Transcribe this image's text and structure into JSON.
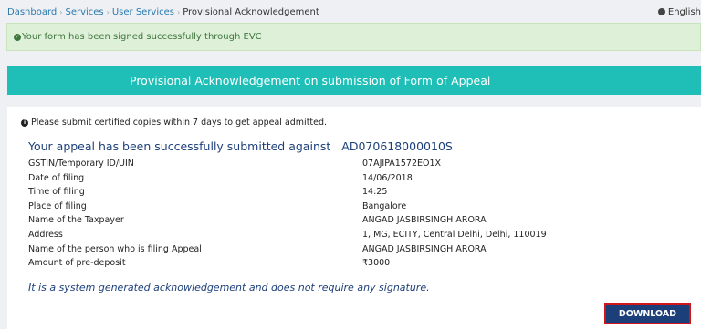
{
  "breadcrumb": {
    "items": [
      "Dashboard",
      "Services",
      "User Services"
    ],
    "current": "Provisional Acknowledgement"
  },
  "language": {
    "label": "English",
    "icon": "globe-icon"
  },
  "alert": {
    "text": "Your form has been signed successfully through EVC",
    "icon": "check-circle-icon",
    "color": "#3c763d"
  },
  "banner": {
    "title": "Provisional Acknowledgement on submission of Form of Appeal",
    "color": "#1fbfb8"
  },
  "note": {
    "icon": "info-icon",
    "text": "Please submit certified copies within 7 days to get appeal admitted."
  },
  "heading": {
    "text": "Your appeal has been successfully submitted against",
    "reference": "AD070618000010S"
  },
  "details": [
    {
      "label": "GSTIN/Temporary ID/UIN",
      "value": "07AJIPA1572EO1X"
    },
    {
      "label": "Date of filing",
      "value": "14/06/2018"
    },
    {
      "label": "Time of filing",
      "value": "14:25"
    },
    {
      "label": "Place of filing",
      "value": "Bangalore"
    },
    {
      "label": "Name of the Taxpayer",
      "value": "ANGAD JASBIRSINGH ARORA"
    },
    {
      "label": "Address",
      "value": "1, MG, ECITY, Central Delhi, Delhi, 110019"
    },
    {
      "label": "Name of the person who is filing Appeal",
      "value": "ANGAD JASBIRSINGH ARORA"
    },
    {
      "label": "Amount of pre-deposit",
      "value": "₹3000"
    }
  ],
  "footnote": "It is a system generated acknowledgement and does not require any signature.",
  "actions": {
    "download_label": "DOWNLOAD",
    "button_color": "#1c3f7a",
    "highlight_color": "#d0151b"
  }
}
